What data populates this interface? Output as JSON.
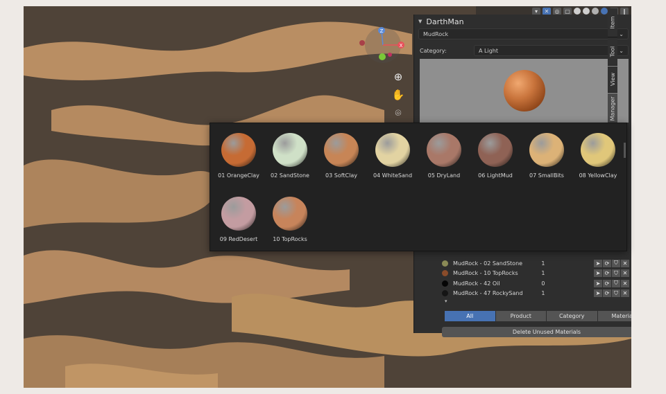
{
  "npanel": {
    "title": "DarthMan",
    "material_select": "MudRock",
    "category_label": "Category:",
    "category_value": "A Light",
    "tabs": [
      "Item",
      "Tool",
      "View",
      "Darth Manager"
    ]
  },
  "popup": {
    "items": [
      {
        "label": "01 OrangeClay",
        "color": "#c66b34"
      },
      {
        "label": "02 SandStone",
        "color": "#cfe0c7"
      },
      {
        "label": "03 SoftClay",
        "color": "#c78556"
      },
      {
        "label": "04 WhiteSand",
        "color": "#e2d3a2"
      },
      {
        "label": "05 DryLand",
        "color": "#a97868"
      },
      {
        "label": "06 LightMud",
        "color": "#8f6255"
      },
      {
        "label": "07 SmallBits",
        "color": "#dcb277"
      },
      {
        "label": "08 YellowClay",
        "color": "#e0c77a"
      },
      {
        "label": "09 RedDesert",
        "color": "#c39ca1"
      },
      {
        "label": "10 TopRocks",
        "color": "#c7845b"
      }
    ]
  },
  "materials": [
    {
      "name": "MudRock - 02 SandStone",
      "count": "1",
      "color": "#8a8a56"
    },
    {
      "name": "MudRock - 10 TopRocks",
      "count": "1",
      "color": "#8a4c2a"
    },
    {
      "name": "MudRock - 42 Oil",
      "count": "0",
      "color": "#050505"
    },
    {
      "name": "MudRock - 47 RockySand",
      "count": "1",
      "color": "#151515"
    }
  ],
  "filters": {
    "tabs": [
      "All",
      "Product",
      "Category",
      "Material"
    ],
    "active": "All"
  },
  "delete_label": "Delete Unused Materials",
  "gizmo": {
    "z_label": "Z",
    "x_label": "X"
  }
}
